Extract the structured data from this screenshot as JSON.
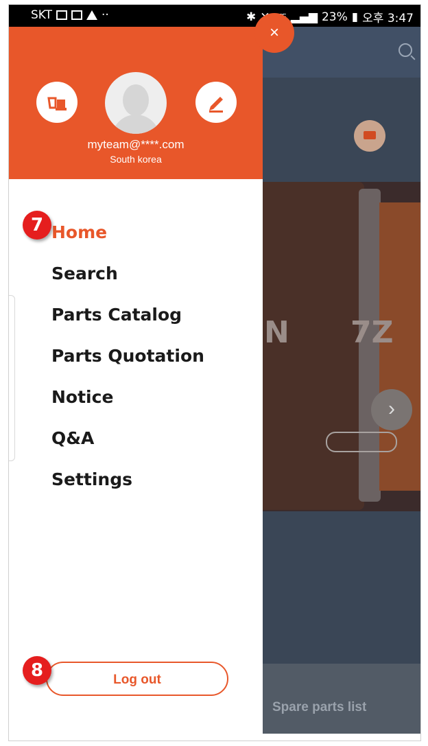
{
  "status_bar": {
    "carrier": "SKT",
    "dots": "··",
    "network": "LTE",
    "battery": "23%",
    "time": "오후 3:47"
  },
  "background": {
    "letter_left": "N",
    "letter_right": "7Z",
    "bottom_label": "Spare parts list"
  },
  "drawer": {
    "close_label": "×",
    "user": {
      "email": "myteam@****.com",
      "country": "South korea"
    },
    "menu": [
      {
        "label": "Home",
        "active": true
      },
      {
        "label": "Search"
      },
      {
        "label": "Parts Catalog"
      },
      {
        "label": "Parts Quotation"
      },
      {
        "label": "Notice"
      },
      {
        "label": "Q&A"
      },
      {
        "label": "Settings"
      }
    ],
    "logout_label": "Log out"
  },
  "annotations": {
    "badge_home": "7",
    "badge_logout": "8"
  },
  "colors": {
    "accent": "#e8572a",
    "badge": "#e51e1e",
    "overlay": "#3a4656"
  },
  "icons": [
    "machine-icon",
    "avatar-icon",
    "edit-icon",
    "close-icon",
    "search-icon",
    "download-icon",
    "chevron-right-icon"
  ]
}
